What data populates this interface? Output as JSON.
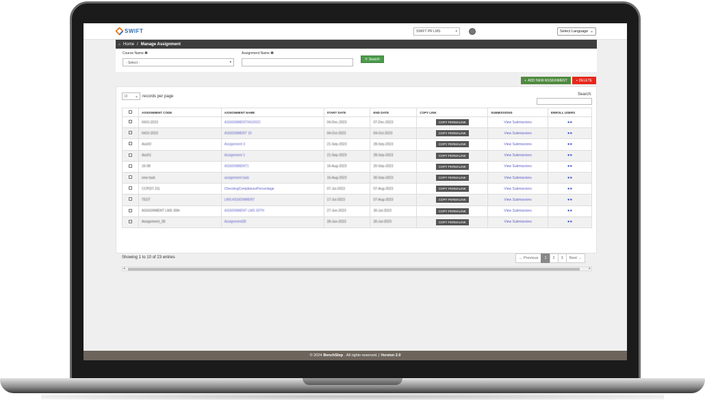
{
  "header": {
    "logo_text": "SWIFT",
    "org_select": "SWIFT PR LMS",
    "language_select": "Select Language"
  },
  "breadcrumb": {
    "home": "Home",
    "separator": "/",
    "current": "Manage Assignment"
  },
  "filters": {
    "course_label": "Course Name ❶",
    "course_value": "- Select -",
    "assignment_label": "Assignment Name ❶",
    "assignment_value": "",
    "search_button": "Search"
  },
  "actions": {
    "add_label": "ADD NEW ASSIGNMENT",
    "delete_label": "DELETE"
  },
  "table_controls": {
    "page_size": "10",
    "records_per_page": "records per page",
    "search_label": "Search:"
  },
  "table": {
    "columns": [
      "ASSIGNMENT CODE",
      "ASSIGNMENT NAME",
      "START DATE",
      "END DATE",
      "COPY LINK",
      "SUBMISSIONS",
      "ENROLL USERS"
    ],
    "permalink_label": "COPY PERMALINK",
    "submissions_label": "View Submissions",
    "rows": [
      {
        "code": "0410-2023",
        "name": "ASSIGNMENT0410023",
        "start": "04-Dec-2023",
        "end": "07-Dec-2023",
        "blurred_name": true
      },
      {
        "code": "0410-2023",
        "name": "ASSIGNMENT 10",
        "start": "04-Oct-2023",
        "end": "04-Oct-2023",
        "blurred_name": true
      },
      {
        "code": "Ass03",
        "name": "Assignment 3",
        "start": "21-Sep-2023",
        "end": "28-Sep-2023",
        "blurred_name": true
      },
      {
        "code": "Ass01",
        "name": "Assignment 1",
        "start": "21-Sep-2023",
        "end": "28-Sep-2023",
        "blurred_name": true
      },
      {
        "code": "16-08",
        "name": "ASSIGNMENT1",
        "start": "16-Aug-2023",
        "end": "20-Sep-2023",
        "blurred_name": true
      },
      {
        "code": "new task",
        "name": "assignment task",
        "start": "16-Aug-2023",
        "end": "30-Sep-2023",
        "blurred_name": true
      },
      {
        "code": "CCP(07.23)",
        "name": "CheckingCompliancePercentage",
        "start": "07-Jul-2023",
        "end": "07-Aug-2023",
        "blurred_name": false
      },
      {
        "code": "TEST",
        "name": "LMS ASSIGNMENT",
        "start": "17-Jul-2023",
        "end": "07-Aug-2023",
        "blurred_name": true
      },
      {
        "code": "ASSIGNMENT LMS 30th",
        "name": "ASSIGNMENT LMS 30TH",
        "start": "27-Jun-2023",
        "end": "30-Jul-2023",
        "blurred_name": true
      },
      {
        "code": "Assignment_28",
        "name": "Assignment28",
        "start": "28-Jun-2023",
        "end": "30-Jul-2023",
        "blurred_name": true
      }
    ]
  },
  "pagination": {
    "showing": "Showing 1 to 10 of 23 entries",
    "previous": "← Previous",
    "pages": [
      "1",
      "2",
      "3"
    ],
    "next": "Next →"
  },
  "footer": {
    "copyright": "© 2024",
    "company": "BenchStep",
    "rights": ". All rights reserved. |",
    "version": "Version 2.0"
  },
  "colors": {
    "add_button": "#4f8a3e",
    "delete_button": "#e8261a",
    "breadcrumb_bar": "#3d3d3d",
    "footer_bar": "#6d645c",
    "link": "#5b5fc7"
  }
}
